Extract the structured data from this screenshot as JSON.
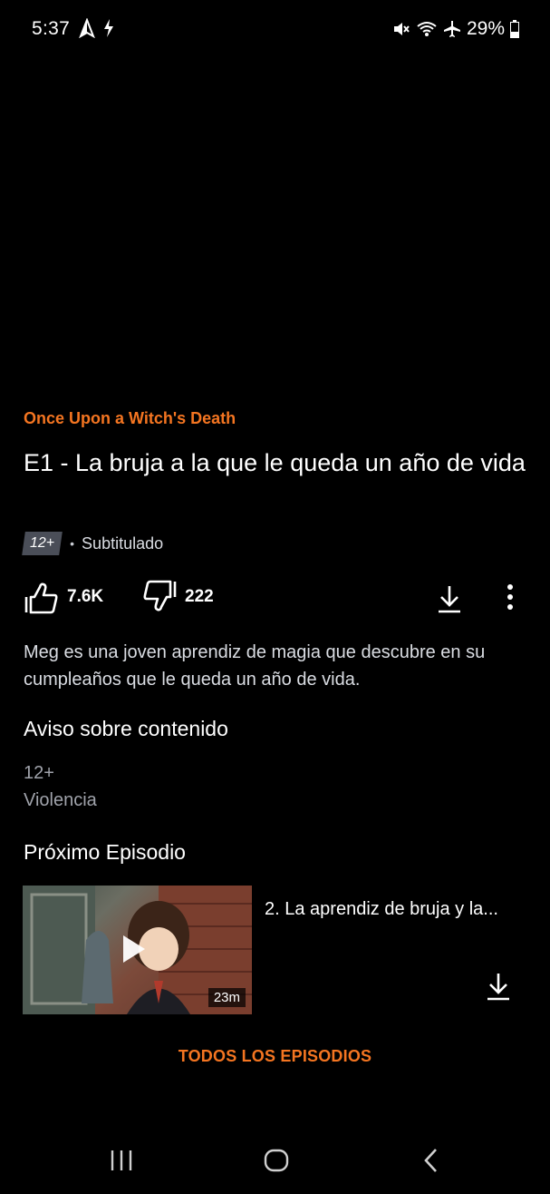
{
  "status_bar": {
    "time": "5:37",
    "battery": "29%",
    "icons_left": [
      "navigation-arrow-icon",
      "flash-icon"
    ],
    "icons_right": [
      "mute-icon",
      "wifi-icon",
      "airplane-icon",
      "battery-icon"
    ]
  },
  "episode": {
    "series_title": "Once Upon a Witch's Death",
    "title": "E1 - La bruja a la que le queda un año de vida",
    "rating": "12+",
    "separator": "•",
    "subtitle_label": "Subtitulado",
    "likes": "7.6K",
    "dislikes": "222",
    "description": "Meg es una joven aprendiz de magia que descubre en su cumpleaños que le queda un año de vida."
  },
  "advisory": {
    "heading": "Aviso sobre contenido",
    "items": [
      "12+",
      "Violencia"
    ]
  },
  "next_episode": {
    "heading": "Próximo Episodio",
    "title": "2. La aprendiz de bruja y la...",
    "duration": "23m"
  },
  "all_episodes_label": "TODOS LOS EPISODIOS",
  "colors": {
    "accent": "#f47521",
    "background": "#000000",
    "muted_text": "#a0a3ab"
  }
}
